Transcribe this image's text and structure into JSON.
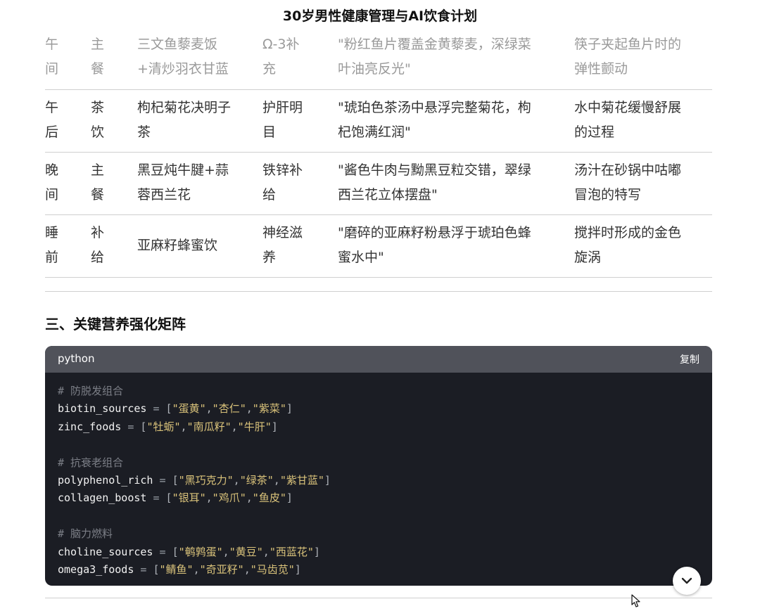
{
  "page": {
    "title": "30岁男性健康管理与AI饮食计划"
  },
  "table": {
    "rows": [
      {
        "time": [
          "午",
          "间"
        ],
        "type": [
          "主",
          "餐"
        ],
        "food": [
          "三文鱼藜麦饭",
          "+清炒羽衣甘蓝"
        ],
        "nutrient": [
          "Ω-3补",
          "充"
        ],
        "prompt": [
          "\"粉红鱼片覆盖金黄藜麦，深绿菜",
          "叶油亮反光\""
        ],
        "shot": [
          "筷子夹起鱼片时的",
          "弹性颤动"
        ]
      },
      {
        "time": [
          "午",
          "后"
        ],
        "type": [
          "茶",
          "饮"
        ],
        "food": [
          "枸杞菊花决明子",
          "茶"
        ],
        "nutrient": [
          "护肝明",
          "目"
        ],
        "prompt": [
          "\"琥珀色茶汤中悬浮完整菊花，枸",
          "杞饱满红润\""
        ],
        "shot": [
          "水中菊花缓慢舒展",
          "的过程"
        ]
      },
      {
        "time": [
          "晚",
          "间"
        ],
        "type": [
          "主",
          "餐"
        ],
        "food": [
          "黑豆炖牛腱+蒜",
          "蓉西兰花"
        ],
        "nutrient": [
          "铁锌补",
          "给"
        ],
        "prompt": [
          "\"酱色牛肉与黝黑豆粒交错，翠绿",
          "西兰花立体摆盘\""
        ],
        "shot": [
          "汤汁在砂锅中咕嘟",
          "冒泡的特写"
        ]
      },
      {
        "time": [
          "睡",
          "前"
        ],
        "type": [
          "补",
          "给"
        ],
        "food": [
          "亚麻籽蜂蜜饮"
        ],
        "nutrient": [
          "神经滋",
          "养"
        ],
        "prompt": [
          "\"磨碎的亚麻籽粉悬浮于琥珀色蜂",
          "蜜水中\""
        ],
        "shot": [
          "搅拌时形成的金色",
          "旋涡"
        ]
      }
    ]
  },
  "section": {
    "heading": "三、关键营养强化矩阵"
  },
  "code": {
    "language": "python",
    "copy_label": "复制",
    "lines": [
      {
        "comment": "# 防脱发组合"
      },
      {
        "name": "biotin_sources",
        "items": [
          "蛋黄",
          "杏仁",
          "紫菜"
        ]
      },
      {
        "name": "zinc_foods",
        "items": [
          "牡蛎",
          "南瓜籽",
          "牛肝"
        ]
      },
      {
        "blank": true
      },
      {
        "comment": "# 抗衰老组合"
      },
      {
        "name": "polyphenol_rich",
        "items": [
          "黑巧克力",
          "绿茶",
          "紫甘蓝"
        ]
      },
      {
        "name": "collagen_boost",
        "items": [
          "银耳",
          "鸡爪",
          "鱼皮"
        ]
      },
      {
        "blank": true
      },
      {
        "comment": "# 脑力燃料"
      },
      {
        "name": "choline_sources",
        "items": [
          "鹌鹑蛋",
          "黄豆",
          "西蓝花"
        ]
      },
      {
        "name": "omega3_foods",
        "items": [
          "鲭鱼",
          "奇亚籽",
          "马齿苋"
        ]
      }
    ]
  },
  "icons": {
    "scroll_down": "chevron-down-icon",
    "cursor": "mouse-pointer-icon"
  }
}
